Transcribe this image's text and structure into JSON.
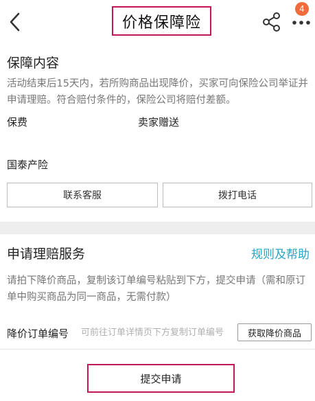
{
  "header": {
    "title": "价格保障险",
    "badge_count": "4"
  },
  "coverage": {
    "title": "保障内容",
    "description": "活动结束后15天内，若所购商品出现降价，买家可向保险公司举证并申请理赔。符合赔付条件的，保险公司将赔付差额。",
    "fee_label": "保费",
    "fee_value": "卖家赠送",
    "insurer": "国泰产险",
    "contact_button": "联系客服",
    "call_button": "拨打电话"
  },
  "claim": {
    "title": "申请理赔服务",
    "help_link": "规则及帮助",
    "description": "请拍下降价商品，复制该订单编号粘贴到下方，提交申请（需和原订单中购买商品为同一商品，无需付款）",
    "order_label": "降价订单编号",
    "order_placeholder": "可前往订单详情页下方复制订单编号",
    "get_button": "获取降价商品",
    "submit_button": "提交申请"
  },
  "colors": {
    "accent_link": "#28a5c4",
    "badge": "#f26b3a",
    "highlight_border": "#c2185b"
  },
  "icons": {
    "back": "back-icon",
    "share": "share-icon",
    "more": "more-icon"
  }
}
